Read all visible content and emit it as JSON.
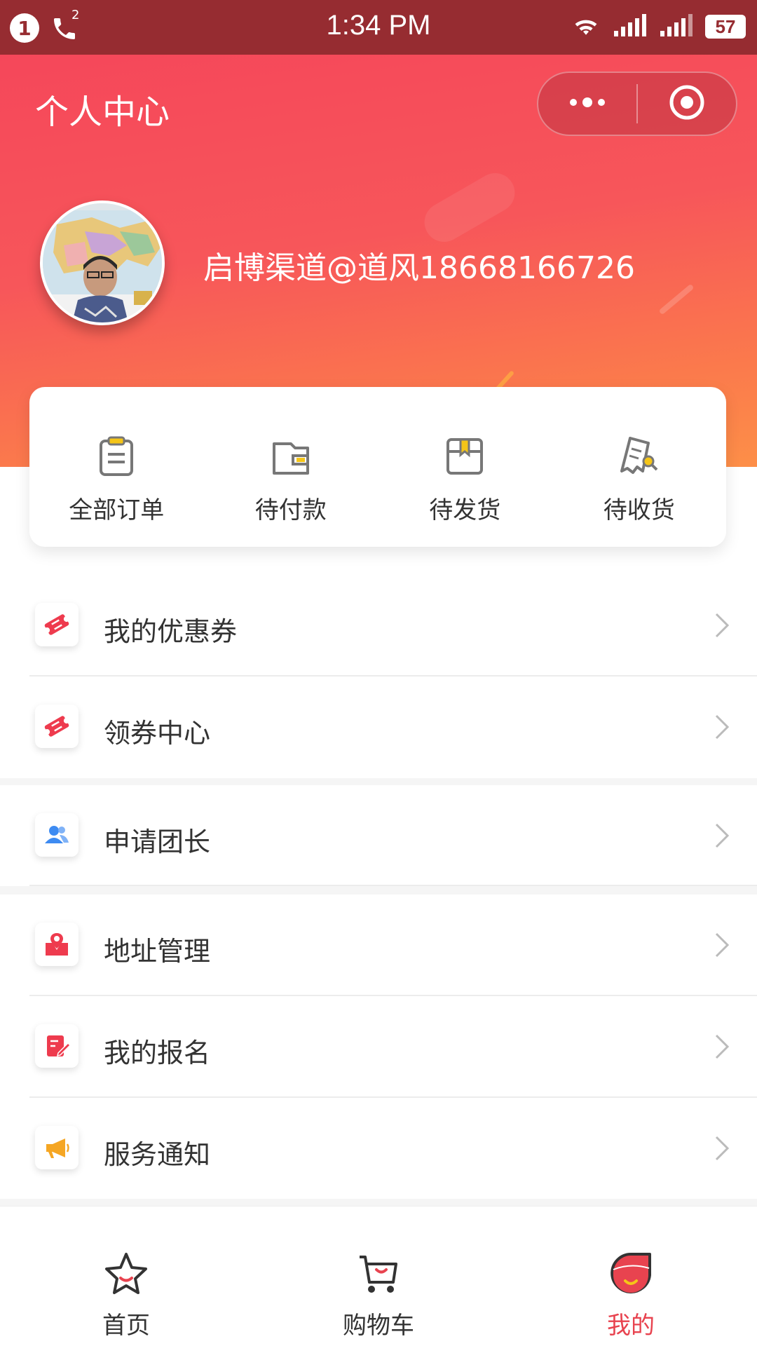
{
  "status_bar": {
    "notification_count": "1",
    "call_badge": "2",
    "time": "1:34 PM",
    "battery": "57"
  },
  "header": {
    "title": "个人中心",
    "username": "启博渠道@道风18668166726"
  },
  "orders": [
    {
      "label": "全部订单",
      "icon": "clipboard-icon"
    },
    {
      "label": "待付款",
      "icon": "wallet-icon"
    },
    {
      "label": "待发货",
      "icon": "box-icon"
    },
    {
      "label": "待收货",
      "icon": "receipt-search-icon"
    }
  ],
  "menu": [
    {
      "label": "我的优惠券",
      "icon": "coupon-icon",
      "color": "#ee3b4e"
    },
    {
      "label": "领券中心",
      "icon": "coupon-icon",
      "color": "#ee3b4e"
    },
    {
      "label": "申请团长",
      "icon": "users-icon",
      "color": "#3d8bf2"
    },
    {
      "label": "地址管理",
      "icon": "location-icon",
      "color": "#ee3b4e"
    },
    {
      "label": "我的报名",
      "icon": "edit-icon",
      "color": "#ee3b4e"
    },
    {
      "label": "服务通知",
      "icon": "megaphone-icon",
      "color": "#f5a623"
    }
  ],
  "tabbar": [
    {
      "label": "首页",
      "icon": "star-icon",
      "active": false
    },
    {
      "label": "购物车",
      "icon": "cart-icon",
      "active": false
    },
    {
      "label": "我的",
      "icon": "profile-icon",
      "active": true
    }
  ],
  "colors": {
    "status_bar": "#962c31",
    "accent": "#e8434f",
    "gradient_top": "#f5475a",
    "gradient_bottom": "#fd8f48"
  }
}
